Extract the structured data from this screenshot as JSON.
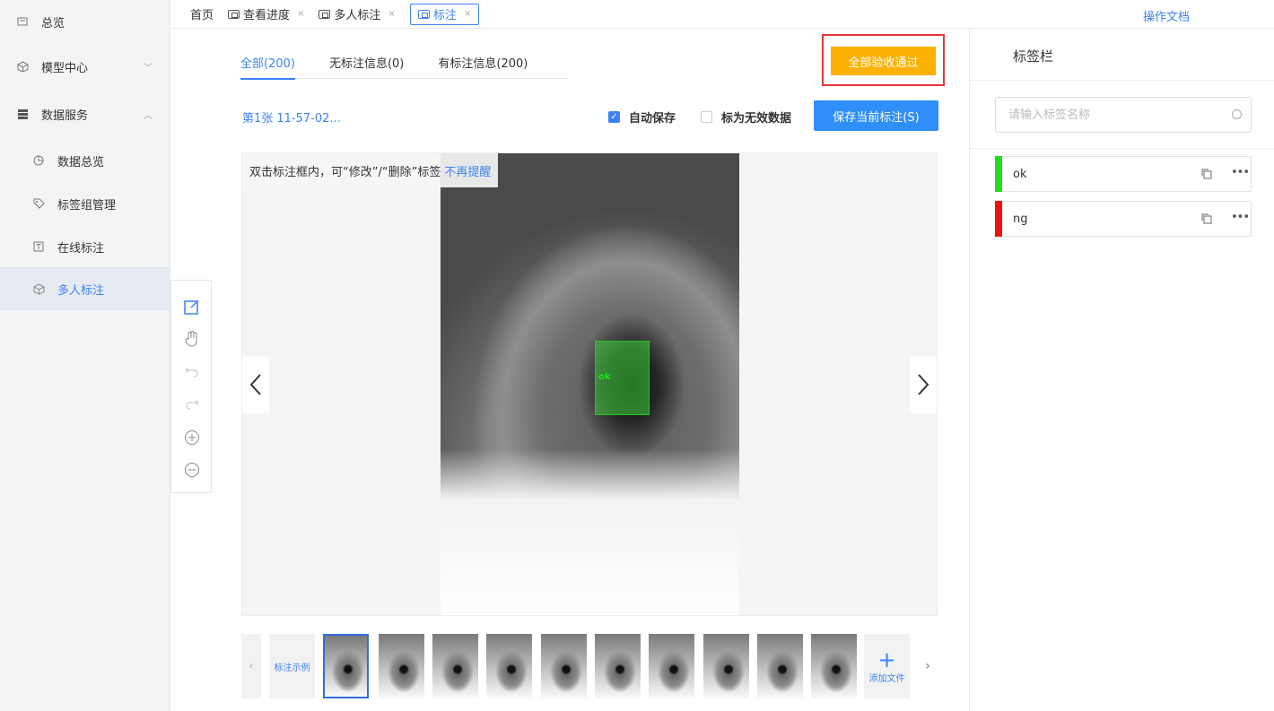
{
  "sidebar": {
    "items": [
      {
        "label": "总览",
        "icon": "overview-icon"
      },
      {
        "label": "模型中心",
        "icon": "cube-icon"
      },
      {
        "label": "数据服务",
        "icon": "database-icon"
      }
    ],
    "sub_items": [
      {
        "label": "数据总览",
        "icon": "pie-chart-icon"
      },
      {
        "label": "标签组管理",
        "icon": "tag-icon"
      },
      {
        "label": "在线标注",
        "icon": "text-box-icon"
      },
      {
        "label": "多人标注",
        "icon": "multi-user-icon"
      }
    ]
  },
  "topbar": {
    "tabs": [
      {
        "label": "首页"
      },
      {
        "label": "查看进度"
      },
      {
        "label": "多人标注"
      },
      {
        "label": "标注"
      }
    ],
    "close_glyph": "×",
    "doc_link": "操作文档"
  },
  "main": {
    "filter_tabs": [
      "全部(200)",
      "无标注信息(0)",
      "有标注信息(200)"
    ],
    "accept_all_label": "全部验收通过",
    "image_name": "第1张 11-57-02...",
    "auto_save_label": "自动保存",
    "auto_save_checked": true,
    "invalid_data_label": "标为无效数据",
    "invalid_data_checked": false,
    "save_label": "保存当前标注(S)",
    "hint_text": "双击标注框内，可“修改”/“删除”标签",
    "hint_link": "不再提醒",
    "bbox_label": "ok"
  },
  "toolbox": [
    "edit-icon",
    "hand-icon",
    "undo-icon",
    "redo-icon",
    "zoom-in-icon",
    "zoom-out-icon"
  ],
  "thumbnails": {
    "example_label": "标注示例",
    "count": 10,
    "add_label": "添加文件"
  },
  "right_panel": {
    "title": "标签栏",
    "search_placeholder": "请输入标签名称",
    "labels": [
      {
        "name": "ok",
        "color": "#22dd22"
      },
      {
        "name": "ng",
        "color": "#ee1111"
      }
    ]
  },
  "colors": {
    "accent": "#3b82f6",
    "accept_button": "#fbb106",
    "save_button": "#2f8ff8",
    "highlight_border": "#e53935"
  }
}
